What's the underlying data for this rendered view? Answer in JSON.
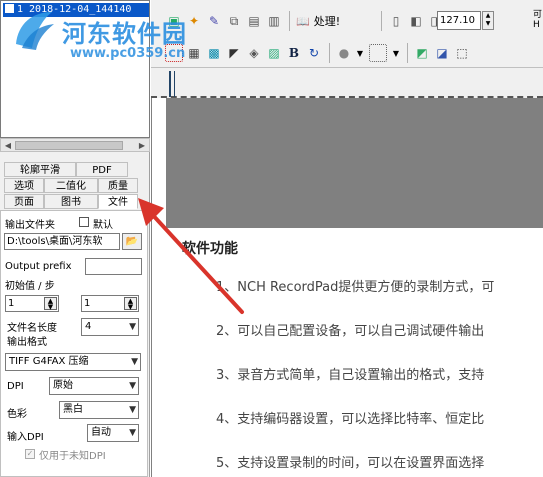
{
  "file_list": {
    "items": [
      {
        "label": "1  2018-12-04_144140"
      }
    ]
  },
  "tabs": {
    "row1": [
      "轮廓平滑",
      "PDF"
    ],
    "row2": [
      "选项",
      "二值化",
      "质量"
    ],
    "row3": [
      "页面",
      "图书",
      "文件"
    ]
  },
  "settings": {
    "output_folder_label": "输出文件夹",
    "default_label": "默认",
    "output_path": "D:\\tools\\桌面\\河东软",
    "output_prefix_label": "Output prefix",
    "output_prefix_value": "",
    "initial_label": "初始值 / 步",
    "initial_value": "1",
    "step_value": "1",
    "filename_length_label": "文件名长度",
    "filename_length_value": "4",
    "output_format_label": "输出格式",
    "output_format_value": "TIFF G4FAX 压缩",
    "dpi_label": "DPI",
    "dpi_value": "原始",
    "color_label": "色彩",
    "color_value": "黑白",
    "input_dpi_label": "输入DPI",
    "input_dpi_value": "自动",
    "unknown_dpi_label": "仅用于未知DPI"
  },
  "toolbar": {
    "process_label": "处理!",
    "zoom_value": "127.10",
    "right_label_top": "可",
    "right_label_bottom": "H"
  },
  "watermark": {
    "name": "河东软件园",
    "url": "www.pc0359.cn"
  },
  "document": {
    "title": "软件功能",
    "lines": [
      "1、NCH RecordPad提供更方便的录制方式，可",
      "2、可以自己配置设备，可以自己调试硬件输出",
      "3、录音方式简单，自己设置输出的格式，支持",
      "4、支持编码器设置，可以选择比特率、恒定比",
      "5、支持设置录制的时间，可以在设置界面选择"
    ]
  },
  "colors": {
    "selection": "#0a58c8",
    "annotation_arrow": "#d9342b",
    "canvas_gray": "#808080"
  }
}
